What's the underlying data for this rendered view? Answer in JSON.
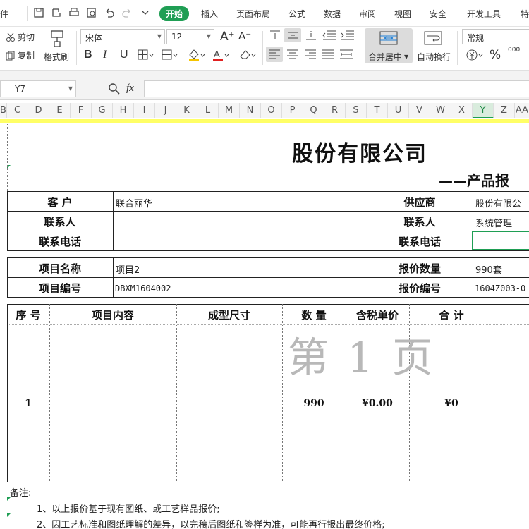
{
  "menubar": {
    "file_label": "件",
    "tabs": [
      "开始",
      "插入",
      "页面布局",
      "公式",
      "数据",
      "审阅",
      "视图",
      "安全",
      "开发工具",
      "特"
    ]
  },
  "ribbon": {
    "cut": "剪切",
    "copy": "复制",
    "format_painter": "格式刷",
    "font_name": "宋体",
    "font_size": "12",
    "grow_font": "A⁺",
    "shrink_font": "A⁻",
    "bold": "B",
    "italic": "I",
    "underline": "U",
    "merge_center": "合并居中",
    "wrap_text": "自动换行",
    "number_format": "常规",
    "percent": "%",
    "thousands": "000"
  },
  "formula": {
    "cell_ref": "Y7",
    "fx": "fx",
    "content": ""
  },
  "columns": [
    "B",
    "C",
    "D",
    "E",
    "F",
    "G",
    "H",
    "I",
    "J",
    "K",
    "L",
    "M",
    "N",
    "O",
    "P",
    "Q",
    "R",
    "S",
    "T",
    "U",
    "V",
    "W",
    "X",
    "Y",
    "Z",
    "AA"
  ],
  "selected_column": "Y",
  "sheet": {
    "title": "股份有限公司",
    "subtitle": "——产品报",
    "customer_label": "客  户",
    "customer_value": "联合丽华",
    "supplier_label": "供应商",
    "supplier_value": "股份有限公",
    "contact_left_label": "联系人",
    "contact_left_value": "",
    "contact_right_label": "联系人",
    "contact_right_value": "系统管理",
    "phone_left_label": "联系电话",
    "phone_left_value": "",
    "phone_right_label": "联系电话",
    "phone_right_value": "",
    "project_name_label": "项目名称",
    "project_name_value": "项目2",
    "quote_qty_label": "报价数量",
    "quote_qty_value": "990套",
    "project_no_label": "项目编号",
    "project_no_value": "DBXM1604002",
    "quote_no_label": "报价编号",
    "quote_no_value": "1604Z003-0",
    "table_headers": [
      "序 号",
      "项目内容",
      "成型尺寸",
      "数 量",
      "含税单价",
      "合 计"
    ],
    "row": {
      "index": "1",
      "content": "",
      "size": "",
      "qty": "990",
      "unit_price": "¥0.00",
      "total": "¥0"
    },
    "watermark": "第 1 页",
    "remarks_label": "备注:",
    "remarks": [
      "1、以上报价基于现有图纸、或工艺样品报价;",
      "2、因工艺标准和图纸理解的差异，以完稿后图纸和签样为准，可能再行报出最终价格;"
    ]
  },
  "colors": {
    "accent": "#1f9e54",
    "selected_col_bg": "#d9ecdd",
    "header_highlight": "#ffff66"
  }
}
